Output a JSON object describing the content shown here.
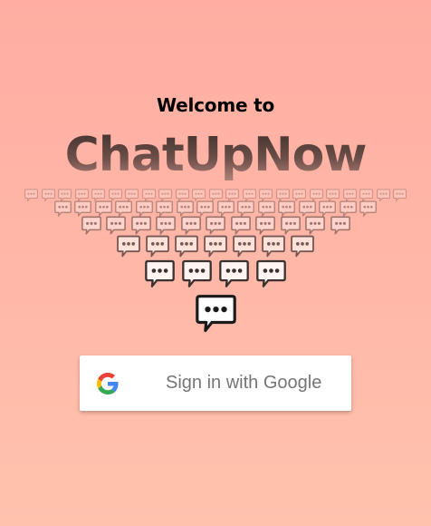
{
  "header": {
    "welcome_text": "Welcome to",
    "app_name": "ChatUpNow"
  },
  "decoration": {
    "icon": "chat-bubble-icon"
  },
  "signin": {
    "label": "Sign in with Google",
    "icon": "google-logo-icon"
  },
  "colors": {
    "background_top": "#ffada2",
    "background_bottom": "#ffc2ad",
    "title": "#4a3733",
    "button_text": "#757575"
  }
}
